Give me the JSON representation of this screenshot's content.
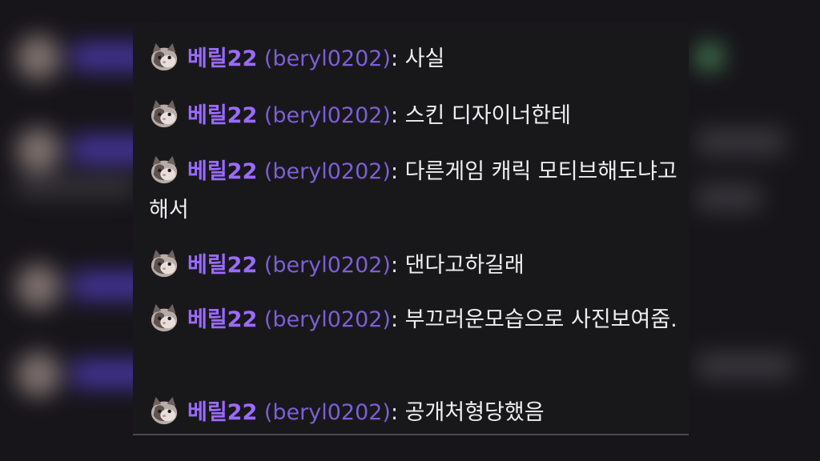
{
  "chat": {
    "messages": [
      {
        "display_name": "베릴22",
        "login": "(beryl0202)",
        "separator": ": ",
        "text": "사실"
      },
      {
        "display_name": "베릴22",
        "login": "(beryl0202)",
        "separator": ": ",
        "text": "스킨 디자이너한테"
      },
      {
        "display_name": "베릴22",
        "login": "(beryl0202)",
        "separator": ": ",
        "text": "다른게임 캐릭 모티브해도냐고해서"
      },
      {
        "display_name": "베릴22",
        "login": "(beryl0202)",
        "separator": ": ",
        "text": "댄다고하길래"
      },
      {
        "display_name": "베릴22",
        "login": "(beryl0202)",
        "separator": ": ",
        "text": "부끄러운모습으로 사진보여줌."
      },
      {
        "display_name": "베릴22",
        "login": "(beryl0202)",
        "separator": ": ",
        "text": "공개처형당했음"
      }
    ],
    "avatar_icon": "cat-avatar-icon",
    "colors": {
      "display_name": "#9b6bff",
      "login": "#7d5fd6",
      "text": "#efeff1",
      "panel_bg": "#18181b"
    }
  }
}
